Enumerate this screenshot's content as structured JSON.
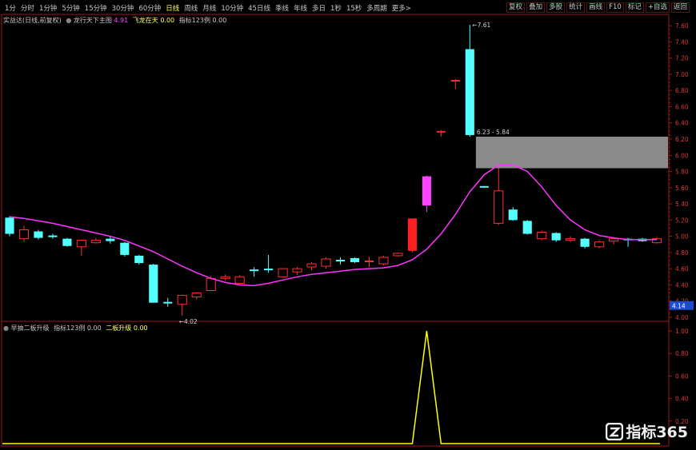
{
  "toolbar": {
    "left": [
      "1分",
      "分时",
      "1分钟",
      "5分钟",
      "15分钟",
      "30分钟",
      "60分钟",
      "日线",
      "周线",
      "月线",
      "10分钟",
      "45日线",
      "季线",
      "年线",
      "多日",
      "1秒",
      "15秒",
      "多周期",
      "更多>"
    ],
    "selected_index": 7,
    "right": [
      "复权",
      "叠加",
      "多股",
      "统计",
      "画线",
      "F10",
      "标记",
      "+自选",
      "返回"
    ]
  },
  "main_info": {
    "stock": "实益达(日线,前复权)",
    "indicator": "龙行天下主图",
    "val1": "4.91",
    "label2": "飞龙在天",
    "val2": "0.00",
    "label3": "指标123例",
    "val3": "0.00"
  },
  "sub_info": {
    "title": "早抽二板升级",
    "label1": "指标123例",
    "val1": "0.00",
    "label2": "二板升级",
    "val2": "0.00"
  },
  "price_axis": {
    "ticks": [
      "7.60",
      "7.40",
      "7.20",
      "7.00",
      "6.80",
      "6.60",
      "6.40",
      "6.20",
      "6.00",
      "5.80",
      "5.60",
      "5.40",
      "5.20",
      "5.00",
      "4.80",
      "4.60",
      "4.40",
      "4.20",
      "4.00"
    ],
    "current": "4.14"
  },
  "sub_axis": {
    "ticks": [
      "1.00",
      "0.80",
      "0.60",
      "0.40",
      "0.20"
    ]
  },
  "chart_data": {
    "type": "candlestick",
    "y_range": [
      3.95,
      7.7
    ],
    "candles": [
      {
        "o": 5.03,
        "c": 5.23,
        "h": 5.25,
        "l": 5.0,
        "up": false
      },
      {
        "o": 4.97,
        "c": 5.08,
        "h": 5.13,
        "l": 4.93,
        "up": true
      },
      {
        "o": 5.06,
        "c": 4.98,
        "h": 5.08,
        "l": 4.96,
        "up": false
      },
      {
        "o": 4.99,
        "c": 5.01,
        "h": 5.03,
        "l": 4.97,
        "up": false
      },
      {
        "o": 4.97,
        "c": 4.88,
        "h": 4.98,
        "l": 4.87,
        "up": false
      },
      {
        "o": 4.87,
        "c": 4.95,
        "h": 4.96,
        "l": 4.76,
        "up": true
      },
      {
        "o": 4.92,
        "c": 4.95,
        "h": 4.98,
        "l": 4.91,
        "up": true
      },
      {
        "o": 4.97,
        "c": 4.94,
        "h": 5.0,
        "l": 4.91,
        "up": false
      },
      {
        "o": 4.92,
        "c": 4.77,
        "h": 4.93,
        "l": 4.75,
        "up": false
      },
      {
        "o": 4.76,
        "c": 4.67,
        "h": 4.77,
        "l": 4.65,
        "up": false
      },
      {
        "o": 4.65,
        "c": 4.18,
        "h": 4.66,
        "l": 4.18,
        "up": false
      },
      {
        "o": 4.19,
        "c": 4.18,
        "h": 4.24,
        "l": 4.13,
        "up": false
      },
      {
        "o": 4.16,
        "c": 4.27,
        "h": 4.28,
        "l": 4.02,
        "up": true
      },
      {
        "o": 4.25,
        "c": 4.3,
        "h": 4.31,
        "l": 4.22,
        "up": true
      },
      {
        "o": 4.33,
        "c": 4.48,
        "h": 4.51,
        "l": 4.33,
        "up": true
      },
      {
        "o": 4.48,
        "c": 4.5,
        "h": 4.53,
        "l": 4.45,
        "up": true
      },
      {
        "o": 4.5,
        "c": 4.42,
        "h": 4.52,
        "l": 4.41,
        "up": true
      },
      {
        "o": 4.58,
        "c": 4.58,
        "h": 4.62,
        "l": 4.5,
        "up": false
      },
      {
        "o": 4.59,
        "c": 4.59,
        "h": 4.77,
        "l": 4.55,
        "up": false
      },
      {
        "o": 4.5,
        "c": 4.6,
        "h": 4.6,
        "l": 4.49,
        "up": true
      },
      {
        "o": 4.6,
        "c": 4.56,
        "h": 4.62,
        "l": 4.52,
        "up": true
      },
      {
        "o": 4.62,
        "c": 4.66,
        "h": 4.68,
        "l": 4.58,
        "up": true
      },
      {
        "o": 4.63,
        "c": 4.72,
        "h": 4.74,
        "l": 4.6,
        "up": true
      },
      {
        "o": 4.7,
        "c": 4.7,
        "h": 4.74,
        "l": 4.65,
        "up": false
      },
      {
        "o": 4.73,
        "c": 4.68,
        "h": 4.74,
        "l": 4.67,
        "up": false
      },
      {
        "o": 4.7,
        "c": 4.69,
        "h": 4.75,
        "l": 4.62,
        "up": true
      },
      {
        "o": 4.66,
        "c": 4.74,
        "h": 4.76,
        "l": 4.64,
        "up": true
      },
      {
        "o": 4.76,
        "c": 4.79,
        "h": 4.8,
        "l": 4.75,
        "up": true
      },
      {
        "o": 4.82,
        "c": 5.22,
        "h": 5.22,
        "l": 4.8,
        "up": true,
        "fill": "#ff2020"
      },
      {
        "o": 5.38,
        "c": 5.74,
        "h": 5.75,
        "l": 5.3,
        "up": false,
        "fill": "#ff44ff",
        "mag": true
      },
      {
        "o": 6.29,
        "c": 6.29,
        "h": 6.31,
        "l": 6.23,
        "up": true,
        "fill": "#ff2020",
        "hline": true
      },
      {
        "o": 6.92,
        "c": 6.92,
        "h": 6.94,
        "l": 6.82,
        "up": true,
        "hline": true
      },
      {
        "o": 6.25,
        "c": 7.31,
        "h": 7.61,
        "l": 6.23,
        "up": false
      },
      {
        "o": 5.61,
        "c": 5.61,
        "h": 5.62,
        "l": 5.6,
        "up": false,
        "hline": true
      },
      {
        "o": 5.16,
        "c": 5.56,
        "h": 5.84,
        "l": 5.14,
        "up": true
      },
      {
        "o": 5.33,
        "c": 5.2,
        "h": 5.36,
        "l": 5.19,
        "up": false
      },
      {
        "o": 5.19,
        "c": 5.03,
        "h": 5.2,
        "l": 5.02,
        "up": false
      },
      {
        "o": 4.97,
        "c": 5.05,
        "h": 5.07,
        "l": 4.95,
        "up": true
      },
      {
        "o": 5.04,
        "c": 4.95,
        "h": 5.05,
        "l": 4.93,
        "up": false
      },
      {
        "o": 4.95,
        "c": 4.97,
        "h": 5.0,
        "l": 4.93,
        "up": true
      },
      {
        "o": 4.97,
        "c": 4.87,
        "h": 4.98,
        "l": 4.85,
        "up": false
      },
      {
        "o": 4.87,
        "c": 4.93,
        "h": 4.95,
        "l": 4.85,
        "up": true
      },
      {
        "o": 4.94,
        "c": 4.97,
        "h": 4.99,
        "l": 4.9,
        "up": true
      },
      {
        "o": 4.97,
        "c": 4.96,
        "h": 4.98,
        "l": 4.87,
        "up": false
      },
      {
        "o": 4.97,
        "c": 4.94,
        "h": 4.98,
        "l": 4.93,
        "up": false
      },
      {
        "o": 4.92,
        "c": 4.97,
        "h": 4.99,
        "l": 4.91,
        "up": true
      }
    ],
    "ma": [
      5.24,
      5.22,
      5.19,
      5.16,
      5.12,
      5.08,
      5.04,
      5.0,
      4.95,
      4.88,
      4.81,
      4.72,
      4.63,
      4.55,
      4.48,
      4.43,
      4.4,
      4.39,
      4.42,
      4.46,
      4.5,
      4.53,
      4.55,
      4.57,
      4.59,
      4.6,
      4.61,
      4.64,
      4.71,
      4.84,
      5.03,
      5.27,
      5.55,
      5.76,
      5.88,
      5.88,
      5.8,
      5.61,
      5.38,
      5.2,
      5.08,
      5.01,
      4.98,
      4.96,
      4.96,
      4.96
    ],
    "gray_zone": {
      "from_index": 32,
      "low": 5.84,
      "high": 6.23
    },
    "annotations": {
      "high_label": "7.61",
      "low_label": "4.02",
      "zone_label": "6.23 - 5.84"
    },
    "sub_values": [
      0,
      0,
      0,
      0,
      0,
      0,
      0,
      0,
      0,
      0,
      0,
      0,
      0,
      0,
      0,
      0,
      0,
      0,
      0,
      0,
      0,
      0,
      0,
      0,
      0,
      0,
      0,
      0,
      0,
      1,
      0,
      0,
      0,
      0,
      0,
      0,
      0,
      0,
      0,
      0,
      0,
      0,
      0,
      0,
      0,
      0
    ]
  },
  "colors": {
    "up": "#ff3030",
    "down": "#54ffff",
    "ma": "#ff33ff",
    "sub_line": "#ffff00",
    "axis": "#a01818"
  },
  "brand": "指标365"
}
